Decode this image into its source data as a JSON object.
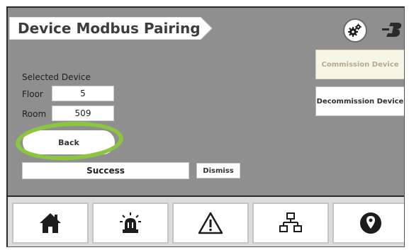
{
  "header": {
    "title": "Device Modbus Pairing",
    "settings_icon": "gear-icon",
    "logo_icon": "brand-logo-icon"
  },
  "actions": {
    "commission_label": "Commission Device",
    "decommission_label": "Decommission Device"
  },
  "device": {
    "section_label": "Selected Device",
    "floor_label": "Floor",
    "floor_value": "5",
    "room_label": "Room",
    "room_value": "509"
  },
  "back_label": "Back",
  "status": {
    "message": "Success",
    "dismiss_label": "Dismiss"
  },
  "nav": {
    "items": [
      {
        "icon": "home-icon"
      },
      {
        "icon": "alarm-icon"
      },
      {
        "icon": "warning-icon"
      },
      {
        "icon": "network-icon"
      },
      {
        "icon": "location-pin-icon"
      }
    ]
  },
  "colors": {
    "panel_background": "#8f8f8f",
    "highlight_ring": "#8cc63f",
    "disabled_button": "#f7f5e6"
  }
}
